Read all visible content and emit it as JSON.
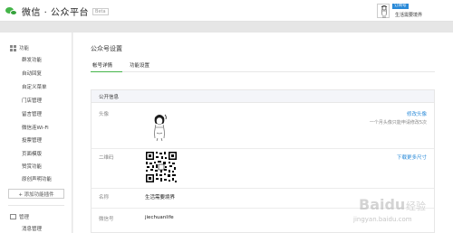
{
  "header": {
    "app_title": "微信 · 公众平台",
    "badge": "Beta",
    "user_tag": "订阅号",
    "user_name": "生活需要境界"
  },
  "sidebar": {
    "section_function_title": "功能",
    "function_items": [
      {
        "label": "群发功能"
      },
      {
        "label": "自动回复"
      },
      {
        "label": "自定义菜单"
      },
      {
        "label": "门店管理"
      },
      {
        "label": "留言管理"
      },
      {
        "label": "微信连Wi-Fi"
      },
      {
        "label": "投票管理"
      },
      {
        "label": "页面模版"
      },
      {
        "label": "赞赏功能"
      },
      {
        "label": "原创声明功能"
      }
    ],
    "add_plugin_label": "+ 添加功能插件",
    "section_manage_title": "管理",
    "manage_items": [
      {
        "label": "消息管理"
      }
    ]
  },
  "main": {
    "page_title": "公众号设置",
    "tabs": [
      {
        "label": "帐号详情",
        "active": true
      },
      {
        "label": "功能设置",
        "active": false
      }
    ],
    "panel_title": "公开信息",
    "rows": {
      "avatar": {
        "label": "头像",
        "link": "修改头像",
        "note": "一个月头像只能申请修改5次"
      },
      "qrcode": {
        "label": "二维码",
        "link": "下载更多尺寸"
      },
      "name": {
        "label": "名称",
        "value": "生活需要境界"
      },
      "wechat_id": {
        "label": "微信号",
        "value": "jiechuanlife"
      }
    }
  },
  "watermark": {
    "text": "jingyan.baidu.com",
    "brand": "Baidu 经验"
  },
  "colors": {
    "accent_green": "#44b549",
    "link_blue": "#2a8ad8",
    "panel_head_bg": "#f4f5f9"
  },
  "icons": {
    "logo": "wechat-logo-icon",
    "function_section": "grid-icon",
    "manage_section": "manage-icon",
    "qrcode": "qrcode-image",
    "avatar": "sketch-avatar-image"
  }
}
